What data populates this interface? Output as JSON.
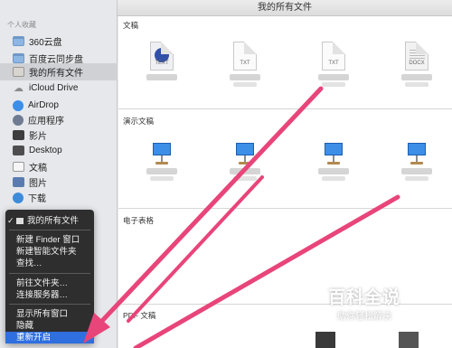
{
  "window": {
    "title": "我的所有文件"
  },
  "sidebar": {
    "heading": "个人收藏",
    "items": [
      {
        "label": "360云盘",
        "icon": "folder-icon"
      },
      {
        "label": "百度云同步盘",
        "icon": "folder-icon"
      },
      {
        "label": "我的所有文件",
        "icon": "all-files-icon",
        "active": true
      },
      {
        "label": "iCloud Drive",
        "icon": "cloud-icon"
      },
      {
        "label": "AirDrop",
        "icon": "airdrop-icon"
      },
      {
        "label": "应用程序",
        "icon": "applications-icon"
      },
      {
        "label": "影片",
        "icon": "movies-icon"
      },
      {
        "label": "Desktop",
        "icon": "desktop-icon"
      },
      {
        "label": "文稿",
        "icon": "documents-icon"
      },
      {
        "label": "图片",
        "icon": "pictures-icon"
      },
      {
        "label": "下载",
        "icon": "downloads-icon"
      }
    ]
  },
  "context_menu": {
    "items": [
      {
        "label": "我的所有文件",
        "checked": true
      },
      {
        "label": "新建 Finder 窗口"
      },
      {
        "label": "新建智能文件夹"
      },
      {
        "label": "查找…"
      },
      {
        "label": "前往文件夹…"
      },
      {
        "label": "连接服务器…"
      },
      {
        "label": "显示所有窗口"
      },
      {
        "label": "隐藏"
      },
      {
        "label": "重新开启",
        "highlighted": true
      }
    ]
  },
  "main": {
    "sections": [
      {
        "title": "文稿",
        "files": [
          {
            "ext": "TEXT",
            "kind": "pages"
          },
          {
            "ext": "TXT",
            "kind": "txt"
          },
          {
            "ext": "TXT",
            "kind": "txt"
          },
          {
            "ext": "DOCX",
            "kind": "docx"
          }
        ]
      },
      {
        "title": "演示文稿",
        "files": [
          {
            "kind": "keynote"
          },
          {
            "kind": "keynote"
          },
          {
            "kind": "keynote"
          },
          {
            "kind": "keynote"
          }
        ]
      },
      {
        "title": "电子表格",
        "files": []
      },
      {
        "title": "PDF 文稿",
        "files": []
      }
    ]
  },
  "watermark": {
    "title": "百科全说",
    "subtitle": "助你轻松解决"
  },
  "colors": {
    "arrow": "#e8457a",
    "menu_highlight": "#2f6fdf",
    "sidebar_bg": "#e6e8eb"
  }
}
